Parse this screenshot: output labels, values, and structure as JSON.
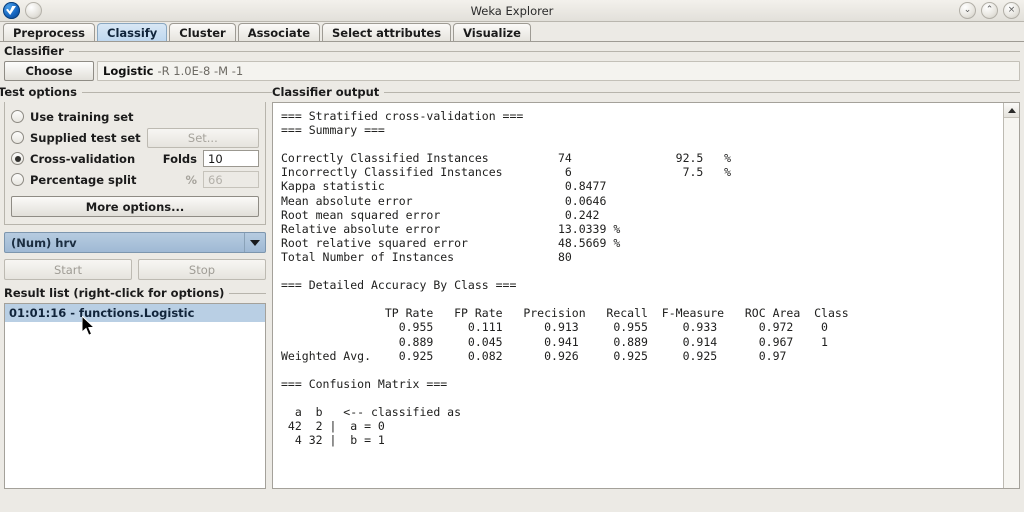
{
  "window": {
    "title": "Weka Explorer",
    "logo_icon": "weka-logo-icon",
    "menu_dot_icon": "window-menu-icon",
    "minimize_glyph": "⌄",
    "maximize_glyph": "⌃",
    "close_glyph": "×"
  },
  "tabs": [
    {
      "label": "Preprocess",
      "active": false
    },
    {
      "label": "Classify",
      "active": true
    },
    {
      "label": "Cluster",
      "active": false
    },
    {
      "label": "Associate",
      "active": false
    },
    {
      "label": "Select attributes",
      "active": false
    },
    {
      "label": "Visualize",
      "active": false
    }
  ],
  "classifier": {
    "section_label": "Classifier",
    "choose_label": "Choose",
    "scheme_name": "Logistic",
    "scheme_args": "-R 1.0E-8 -M -1"
  },
  "test_options": {
    "section_label": "Test options",
    "options": [
      {
        "label": "Use training set",
        "selected": false
      },
      {
        "label": "Supplied test set",
        "selected": false
      },
      {
        "label": "Cross-validation",
        "selected": true
      },
      {
        "label": "Percentage split",
        "selected": false
      }
    ],
    "set_button_label": "Set...",
    "folds_label": "Folds",
    "folds_value": "10",
    "percent_label": "%",
    "percent_value": "66",
    "more_options_label": "More options..."
  },
  "class_combo": {
    "value": "(Num) hrv",
    "arrow_icon": "chevron-down-icon"
  },
  "run_controls": {
    "start_label": "Start",
    "stop_label": "Stop"
  },
  "result_list": {
    "header": "Result list (right-click for options)",
    "items": [
      "01:01:16 - functions.Logistic"
    ]
  },
  "output": {
    "section_label": "Classifier output",
    "scroll_up_icon": "scroll-up-arrow-icon",
    "text": "=== Stratified cross-validation ===\n=== Summary ===\n\nCorrectly Classified Instances          74               92.5   %\nIncorrectly Classified Instances         6                7.5   %\nKappa statistic                          0.8477\nMean absolute error                      0.0646\nRoot mean squared error                  0.242 \nRelative absolute error                 13.0339 %\nRoot relative squared error             48.5669 %\nTotal Number of Instances               80     \n\n=== Detailed Accuracy By Class ===\n\n               TP Rate   FP Rate   Precision   Recall  F-Measure   ROC Area  Class\n                 0.955     0.111      0.913     0.955     0.933      0.972    0\n                 0.889     0.045      0.941     0.889     0.914      0.967    1\nWeighted Avg.    0.925     0.082      0.926     0.925     0.925      0.97 \n\n=== Confusion Matrix ===\n\n  a  b   <-- classified as\n 42  2 |  a = 0\n  4 32 |  b = 1"
  },
  "results_data": {
    "evaluation_mode": "Stratified cross-validation",
    "summary": [
      {
        "metric": "Correctly Classified Instances",
        "value": "74",
        "percent": "92.5"
      },
      {
        "metric": "Incorrectly Classified Instances",
        "value": "6",
        "percent": "7.5"
      },
      {
        "metric": "Kappa statistic",
        "value": "0.8477",
        "percent": ""
      },
      {
        "metric": "Mean absolute error",
        "value": "0.0646",
        "percent": ""
      },
      {
        "metric": "Root mean squared error",
        "value": "0.242",
        "percent": ""
      },
      {
        "metric": "Relative absolute error",
        "value": "13.0339 %",
        "percent": ""
      },
      {
        "metric": "Root relative squared error",
        "value": "48.5669 %",
        "percent": ""
      },
      {
        "metric": "Total Number of Instances",
        "value": "80",
        "percent": ""
      }
    ],
    "accuracy_columns": [
      "TP Rate",
      "FP Rate",
      "Precision",
      "Recall",
      "F-Measure",
      "ROC Area",
      "Class"
    ],
    "accuracy_rows": [
      [
        "0.955",
        "0.111",
        "0.913",
        "0.955",
        "0.933",
        "0.972",
        "0"
      ],
      [
        "0.889",
        "0.045",
        "0.941",
        "0.889",
        "0.914",
        "0.967",
        "1"
      ],
      [
        "0.925",
        "0.082",
        "0.926",
        "0.925",
        "0.925",
        "0.97",
        "Weighted Avg."
      ]
    ],
    "confusion_matrix": {
      "labels": [
        "a",
        "b"
      ],
      "legend": [
        "a = 0",
        "b = 1"
      ],
      "rows": [
        [
          42,
          2
        ],
        [
          4,
          32
        ]
      ]
    }
  },
  "colors": {
    "tab_active": "#bfd8ef",
    "combo_selected": "#9fb9d4",
    "list_selected": "#b9cfe4",
    "panel_bg": "#eceae5"
  }
}
